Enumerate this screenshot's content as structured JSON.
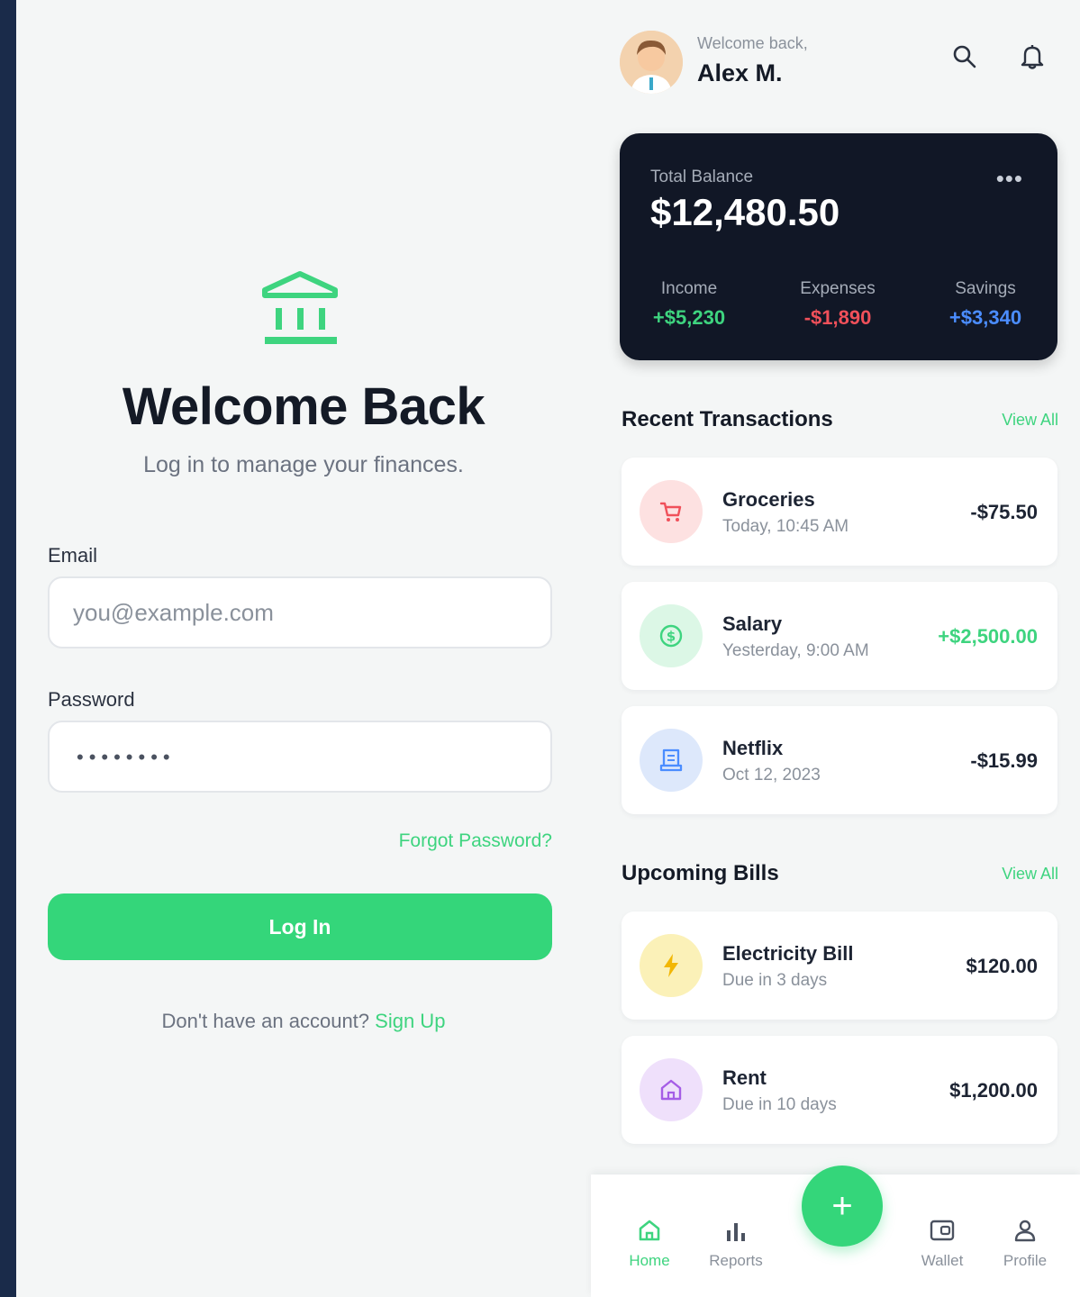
{
  "login": {
    "title": "Welcome Back",
    "subtitle": "Log in to manage your finances.",
    "email_label": "Email",
    "email_placeholder": "you@example.com",
    "password_label": "Password",
    "password_value": "••••••••",
    "forgot": "Forgot Password?",
    "login_button": "Log In",
    "no_account": "Don't have an account?",
    "signup": "Sign Up"
  },
  "dashboard": {
    "header": {
      "greeting": "Welcome back,",
      "user_name": "Alex M."
    },
    "balance": {
      "label": "Total Balance",
      "amount": "$12,480.50",
      "stats": [
        {
          "label": "Income",
          "value": "+$5,230",
          "color": "#3ed47f"
        },
        {
          "label": "Expenses",
          "value": "-$1,890",
          "color": "#f0505a"
        },
        {
          "label": "Savings",
          "value": "+$3,340",
          "color": "#4b8dff"
        }
      ]
    },
    "recent": {
      "title": "Recent Transactions",
      "view_all": "View All",
      "items": [
        {
          "name": "Groceries",
          "sub": "Today, 10:45 AM",
          "amount": "-$75.50",
          "icon": "cart-icon"
        },
        {
          "name": "Salary",
          "sub": "Yesterday, 9:00 AM",
          "amount": "+$2,500.00",
          "icon": "dollar-icon"
        },
        {
          "name": "Netflix",
          "sub": "Oct 12, 2023",
          "amount": "-$15.99",
          "icon": "receipt-icon"
        }
      ]
    },
    "bills": {
      "title": "Upcoming Bills",
      "view_all": "View All",
      "items": [
        {
          "name": "Electricity Bill",
          "sub": "Due in 3 days",
          "amount": "$120.00",
          "icon": "lightning-icon"
        },
        {
          "name": "Rent",
          "sub": "Due in 10 days",
          "amount": "$1,200.00",
          "icon": "home-icon"
        }
      ]
    },
    "nav": {
      "home": "Home",
      "reports": "Reports",
      "fab": "+",
      "wallet": "Wallet",
      "profile": "Profile"
    }
  },
  "colors": {
    "accent": "#34d67a",
    "card_dark": "#111726",
    "expense": "#f0505a",
    "savings": "#4b8dff"
  }
}
